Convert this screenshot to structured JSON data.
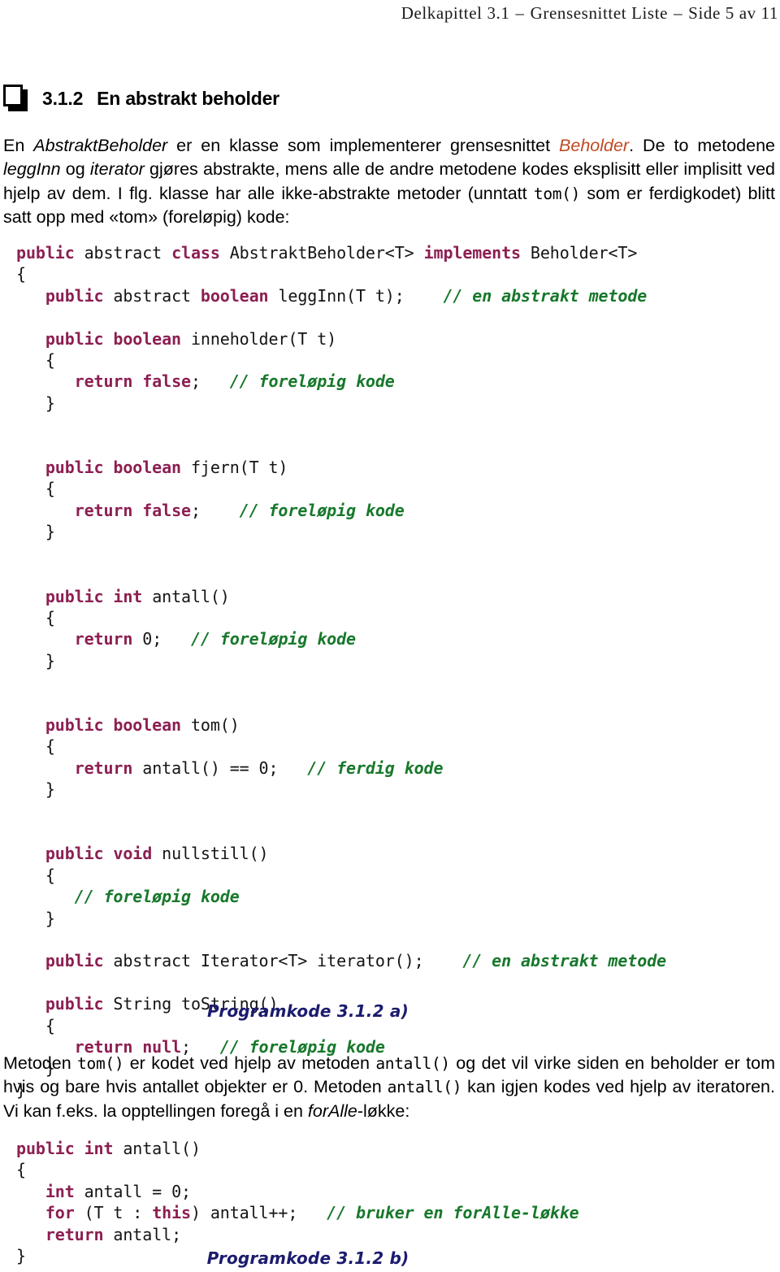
{
  "running_head": {
    "chapter": "Delkapittel 3.1",
    "separator": "–",
    "topic": "Grensesnittet Liste",
    "page": "Side 5 av 11"
  },
  "section": {
    "icon": "book-page-icon",
    "number": "3.1.2",
    "title": "En abstrakt beholder"
  },
  "intro_paragraph": {
    "seg1": "En ",
    "italic1": "AbstraktBeholder",
    "seg2": " er en klasse som implementerer grensesnittet ",
    "link": "Beholder",
    "seg3": ". De to metodene ",
    "italic2": "leggInn",
    "seg4": " og ",
    "italic3": "iterator",
    "seg5": " gjøres abstrakte, mens alle de andre metodene kodes eksplisitt eller implisitt ved hjelp av dem. I flg. klasse har alle ikke-abstrakte metoder (unntatt ",
    "code1": "tom()",
    "seg6": " som er ferdigkodet) blitt satt opp med «tom» (foreløpig) kode:"
  },
  "code_a": {
    "caption": "Programkode 3.1.2 a)",
    "lines": [
      [
        {
          "t": "public",
          "c": "kw"
        },
        {
          "t": " abstract ",
          "c": "pl"
        },
        {
          "t": "class",
          "c": "kw"
        },
        {
          "t": " AbstraktBeholder<T> ",
          "c": "pl"
        },
        {
          "t": "implements",
          "c": "kw"
        },
        {
          "t": " Beholder<T>",
          "c": "pl"
        }
      ],
      [
        {
          "t": "{",
          "c": "pl"
        }
      ],
      [
        {
          "t": "   ",
          "c": "pl"
        },
        {
          "t": "public",
          "c": "kw"
        },
        {
          "t": " abstract ",
          "c": "pl"
        },
        {
          "t": "boolean",
          "c": "kw"
        },
        {
          "t": " leggInn(T t);    ",
          "c": "pl"
        },
        {
          "t": "// en abstrakt metode",
          "c": "cm"
        }
      ],
      [
        {
          "t": "",
          "c": "pl"
        }
      ],
      [
        {
          "t": "   ",
          "c": "pl"
        },
        {
          "t": "public boolean",
          "c": "kw"
        },
        {
          "t": " inneholder(T t)",
          "c": "pl"
        }
      ],
      [
        {
          "t": "   {",
          "c": "pl"
        }
      ],
      [
        {
          "t": "      ",
          "c": "pl"
        },
        {
          "t": "return false",
          "c": "kw"
        },
        {
          "t": ";   ",
          "c": "pl"
        },
        {
          "t": "// foreløpig kode",
          "c": "cm"
        }
      ],
      [
        {
          "t": "   }",
          "c": "pl"
        }
      ],
      [
        {
          "t": "",
          "c": "pl"
        }
      ],
      [
        {
          "t": "",
          "c": "pl"
        }
      ],
      [
        {
          "t": "   ",
          "c": "pl"
        },
        {
          "t": "public boolean",
          "c": "kw"
        },
        {
          "t": " fjern(T t)",
          "c": "pl"
        }
      ],
      [
        {
          "t": "   {",
          "c": "pl"
        }
      ],
      [
        {
          "t": "      ",
          "c": "pl"
        },
        {
          "t": "return false",
          "c": "kw"
        },
        {
          "t": ";    ",
          "c": "pl"
        },
        {
          "t": "// foreløpig kode",
          "c": "cm"
        }
      ],
      [
        {
          "t": "   }",
          "c": "pl"
        }
      ],
      [
        {
          "t": "",
          "c": "pl"
        }
      ],
      [
        {
          "t": "",
          "c": "pl"
        }
      ],
      [
        {
          "t": "   ",
          "c": "pl"
        },
        {
          "t": "public int",
          "c": "kw"
        },
        {
          "t": " antall()",
          "c": "pl"
        }
      ],
      [
        {
          "t": "   {",
          "c": "pl"
        }
      ],
      [
        {
          "t": "      ",
          "c": "pl"
        },
        {
          "t": "return",
          "c": "kw"
        },
        {
          "t": " 0;   ",
          "c": "pl"
        },
        {
          "t": "// foreløpig kode",
          "c": "cm"
        }
      ],
      [
        {
          "t": "   }",
          "c": "pl"
        }
      ],
      [
        {
          "t": "",
          "c": "pl"
        }
      ],
      [
        {
          "t": "",
          "c": "pl"
        }
      ],
      [
        {
          "t": "   ",
          "c": "pl"
        },
        {
          "t": "public boolean",
          "c": "kw"
        },
        {
          "t": " tom()",
          "c": "pl"
        }
      ],
      [
        {
          "t": "   {",
          "c": "pl"
        }
      ],
      [
        {
          "t": "      ",
          "c": "pl"
        },
        {
          "t": "return",
          "c": "kw"
        },
        {
          "t": " antall() == 0;   ",
          "c": "pl"
        },
        {
          "t": "// ferdig kode",
          "c": "cm"
        }
      ],
      [
        {
          "t": "   }",
          "c": "pl"
        }
      ],
      [
        {
          "t": "",
          "c": "pl"
        }
      ],
      [
        {
          "t": "",
          "c": "pl"
        }
      ],
      [
        {
          "t": "   ",
          "c": "pl"
        },
        {
          "t": "public void",
          "c": "kw"
        },
        {
          "t": " nullstill()",
          "c": "pl"
        }
      ],
      [
        {
          "t": "   {",
          "c": "pl"
        }
      ],
      [
        {
          "t": "      ",
          "c": "pl"
        },
        {
          "t": "// foreløpig kode",
          "c": "cm"
        }
      ],
      [
        {
          "t": "   }",
          "c": "pl"
        }
      ],
      [
        {
          "t": "",
          "c": "pl"
        }
      ],
      [
        {
          "t": "   ",
          "c": "pl"
        },
        {
          "t": "public",
          "c": "kw"
        },
        {
          "t": " abstract Iterator<T> iterator();    ",
          "c": "pl"
        },
        {
          "t": "// en abstrakt metode",
          "c": "cm"
        }
      ],
      [
        {
          "t": "",
          "c": "pl"
        }
      ],
      [
        {
          "t": "   ",
          "c": "pl"
        },
        {
          "t": "public",
          "c": "kw"
        },
        {
          "t": " String toString()",
          "c": "pl"
        }
      ],
      [
        {
          "t": "   {",
          "c": "pl"
        }
      ],
      [
        {
          "t": "      ",
          "c": "pl"
        },
        {
          "t": "return null",
          "c": "kw"
        },
        {
          "t": ";   ",
          "c": "pl"
        },
        {
          "t": "// foreløpig kode",
          "c": "cm"
        }
      ],
      [
        {
          "t": "   }",
          "c": "pl"
        }
      ],
      [
        {
          "t": "}",
          "c": "pl"
        }
      ]
    ]
  },
  "mid_paragraph": {
    "seg1": "Metoden ",
    "code1": "tom()",
    "seg2": " er kodet ved hjelp av metoden ",
    "code2": "antall()",
    "seg3": " og det vil virke siden en beholder er tom hvis og bare hvis antallet objekter er 0. Metoden ",
    "code3": "antall()",
    "seg4": " kan igjen kodes ved hjelp av iteratoren. Vi kan f.eks. la opptellingen foregå i en ",
    "italic1": "forAlle",
    "seg5": "-løkke:"
  },
  "code_b": {
    "caption": "Programkode 3.1.2 b)",
    "lines": [
      [
        {
          "t": "public int",
          "c": "kw"
        },
        {
          "t": " antall()",
          "c": "pl"
        }
      ],
      [
        {
          "t": "{",
          "c": "pl"
        }
      ],
      [
        {
          "t": "   ",
          "c": "pl"
        },
        {
          "t": "int",
          "c": "kw"
        },
        {
          "t": " antall = 0;",
          "c": "pl"
        }
      ],
      [
        {
          "t": "   ",
          "c": "pl"
        },
        {
          "t": "for",
          "c": "kw"
        },
        {
          "t": " (T t : ",
          "c": "pl"
        },
        {
          "t": "this",
          "c": "kw"
        },
        {
          "t": ") antall++;   ",
          "c": "pl"
        },
        {
          "t": "// bruker en forAlle-løkke",
          "c": "cm"
        }
      ],
      [
        {
          "t": "   ",
          "c": "pl"
        },
        {
          "t": "return",
          "c": "kw"
        },
        {
          "t": " antall;",
          "c": "pl"
        }
      ],
      [
        {
          "t": "}",
          "c": "pl"
        }
      ]
    ]
  },
  "colors": {
    "keyword": "#8c1f52",
    "comment": "#17782b",
    "caption": "#1b1b6e",
    "link": "#c04a22",
    "text": "#141414"
  }
}
